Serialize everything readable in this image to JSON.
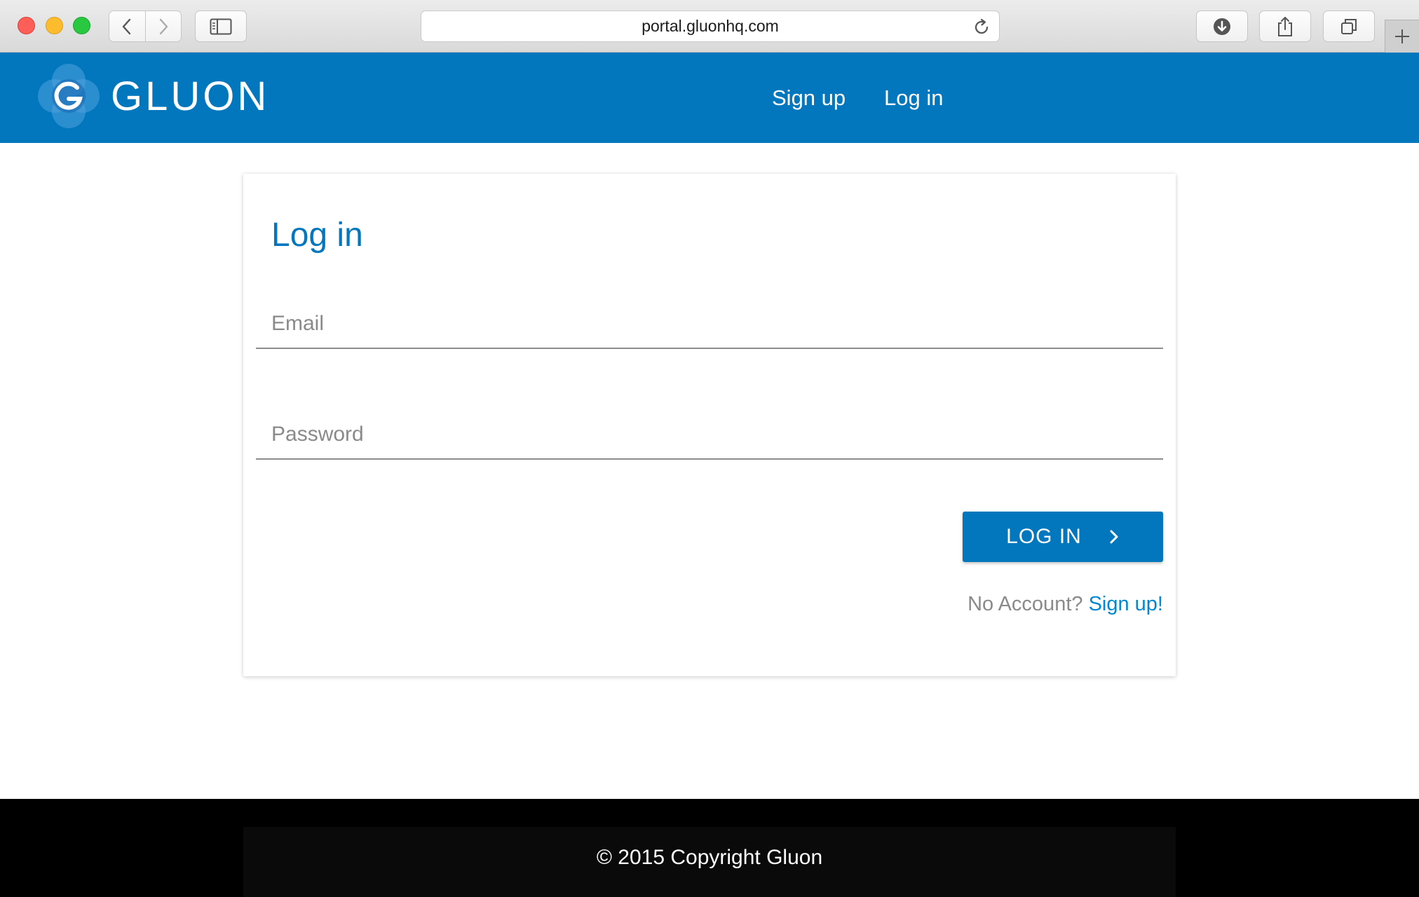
{
  "browser": {
    "url": "portal.gluonhq.com",
    "icons": {
      "back": "chevron-left-icon",
      "forward": "chevron-right-icon",
      "sidebar": "sidebar-icon",
      "reload": "reload-icon",
      "downloads": "download-icon",
      "share": "share-icon",
      "tabs": "tabs-icon",
      "new_tab": "plus-icon"
    }
  },
  "header": {
    "brand": "GLUON",
    "nav": {
      "signup": "Sign up",
      "login": "Log in"
    },
    "color": "#0277bd"
  },
  "form": {
    "title": "Log in",
    "email": {
      "value": "",
      "placeholder": "Email"
    },
    "password": {
      "value": "",
      "placeholder": "Password"
    },
    "submit_label": "LOG IN",
    "no_account_text": "No Account?",
    "signup_link": "Sign up!"
  },
  "footer": {
    "copyright": "© 2015 Copyright Gluon"
  }
}
